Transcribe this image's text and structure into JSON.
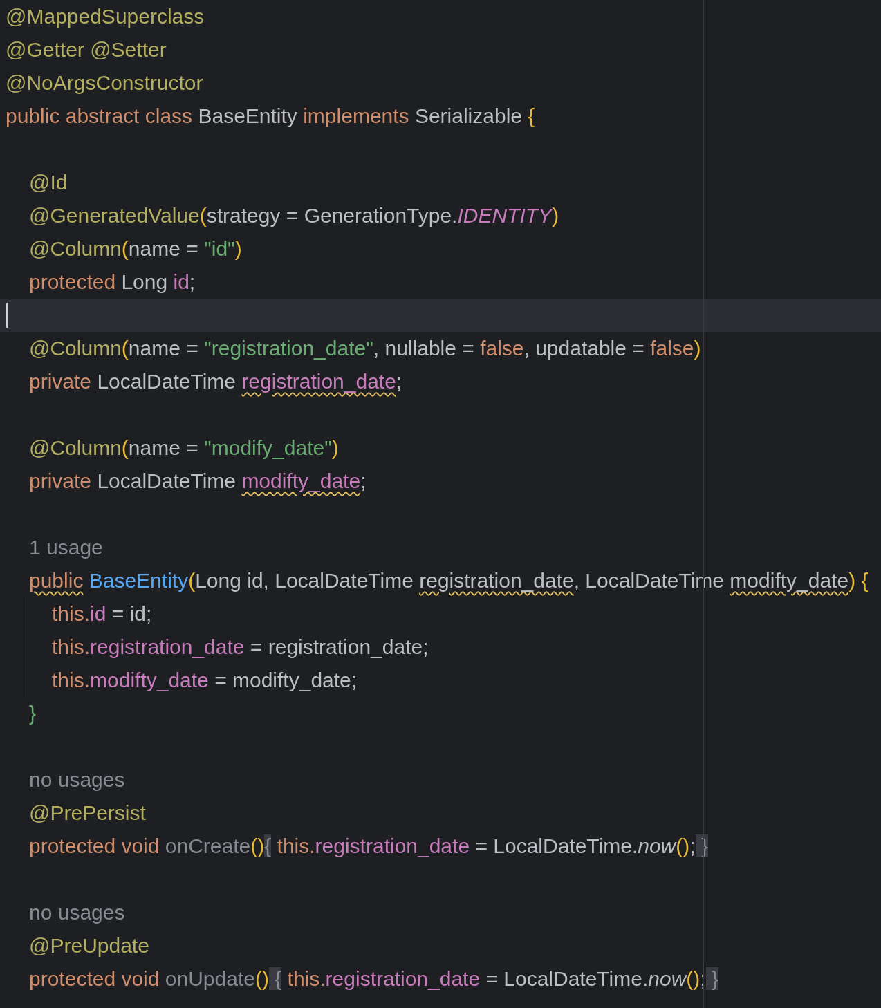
{
  "editor": {
    "lines": [
      {
        "kind": "code",
        "current": false,
        "tokens": [
          {
            "text": "@MappedSuperclass",
            "kind": "annotation"
          }
        ]
      },
      {
        "kind": "code",
        "current": false,
        "tokens": [
          {
            "text": "@Getter @Setter",
            "kind": "annotation"
          }
        ]
      },
      {
        "kind": "code",
        "current": false,
        "tokens": [
          {
            "text": "@NoArgsConstructor",
            "kind": "annotation"
          }
        ]
      },
      {
        "kind": "code",
        "current": false,
        "tokens": [
          {
            "text": "public abstract class ",
            "kind": "keyword"
          },
          {
            "text": "BaseEntity ",
            "kind": "plain"
          },
          {
            "text": "implements ",
            "kind": "keyword"
          },
          {
            "text": "Serializable ",
            "kind": "plain"
          },
          {
            "text": "{",
            "kind": "bracket"
          }
        ],
        "children": [
          {
            "kind": "blank",
            "current": false
          },
          {
            "kind": "code",
            "current": false,
            "tokens": [
              {
                "text": "@Id",
                "kind": "annotation"
              }
            ]
          },
          {
            "kind": "code",
            "current": false,
            "tokens": [
              {
                "text": "@GeneratedValue",
                "kind": "annotation"
              },
              {
                "text": "(",
                "kind": "bracket"
              },
              {
                "text": "strategy = GenerationType.",
                "kind": "plain"
              },
              {
                "text": "IDENTITY",
                "kind": "constant"
              },
              {
                "text": ")",
                "kind": "bracket"
              }
            ]
          },
          {
            "kind": "code",
            "current": false,
            "tokens": [
              {
                "text": "@Column",
                "kind": "annotation"
              },
              {
                "text": "(",
                "kind": "bracket"
              },
              {
                "text": "name = ",
                "kind": "plain"
              },
              {
                "text": "\"id\"",
                "kind": "string"
              },
              {
                "text": ")",
                "kind": "bracket"
              }
            ]
          },
          {
            "kind": "code",
            "current": false,
            "tokens": [
              {
                "text": "protected ",
                "kind": "keyword"
              },
              {
                "text": "Long ",
                "kind": "plain"
              },
              {
                "text": "id",
                "kind": "field"
              },
              {
                "text": ";",
                "kind": "plain"
              }
            ]
          },
          {
            "kind": "blank",
            "current": true
          },
          {
            "kind": "code",
            "current": false,
            "tokens": [
              {
                "text": "@Column",
                "kind": "annotation"
              },
              {
                "text": "(",
                "kind": "bracket"
              },
              {
                "text": "name = ",
                "kind": "plain"
              },
              {
                "text": "\"registration_date\"",
                "kind": "string"
              },
              {
                "text": ", nullable = ",
                "kind": "plain"
              },
              {
                "text": "false",
                "kind": "keyword"
              },
              {
                "text": ", updatable = ",
                "kind": "plain"
              },
              {
                "text": "false",
                "kind": "keyword"
              },
              {
                "text": ")",
                "kind": "bracket"
              }
            ]
          },
          {
            "kind": "code",
            "current": false,
            "tokens": [
              {
                "text": "private ",
                "kind": "keyword"
              },
              {
                "text": "LocalDateTime ",
                "kind": "plain"
              },
              {
                "text": "registration_date",
                "kind": "field",
                "squiggle": true
              },
              {
                "text": ";",
                "kind": "plain"
              }
            ]
          },
          {
            "kind": "blank",
            "current": false
          },
          {
            "kind": "code",
            "current": false,
            "tokens": [
              {
                "text": "@Column",
                "kind": "annotation"
              },
              {
                "text": "(",
                "kind": "bracket"
              },
              {
                "text": "name = ",
                "kind": "plain"
              },
              {
                "text": "\"modify_date\"",
                "kind": "string"
              },
              {
                "text": ")",
                "kind": "bracket"
              }
            ]
          },
          {
            "kind": "code",
            "current": false,
            "tokens": [
              {
                "text": "private ",
                "kind": "keyword"
              },
              {
                "text": "LocalDateTime ",
                "kind": "plain"
              },
              {
                "text": "modifty_date",
                "kind": "field",
                "squiggle": true
              },
              {
                "text": ";",
                "kind": "plain"
              }
            ]
          },
          {
            "kind": "blank",
            "current": false
          },
          {
            "kind": "hint",
            "current": false,
            "tokens": [
              {
                "text": "1 usage",
                "kind": "hint"
              }
            ]
          },
          {
            "kind": "code",
            "current": false,
            "tokens": [
              {
                "text": "public",
                "kind": "keyword",
                "squiggle": true
              },
              {
                "text": " BaseEntity",
                "kind": "declaration"
              },
              {
                "text": "(",
                "kind": "bracket"
              },
              {
                "text": "Long id, LocalDateTime ",
                "kind": "plain"
              },
              {
                "text": "registration_date",
                "kind": "plain",
                "squiggle": true
              },
              {
                "text": ", LocalDateTime ",
                "kind": "plain"
              },
              {
                "text": "modifty_date",
                "kind": "plain",
                "squiggle": true
              },
              {
                "text": ") {",
                "kind": "bracket"
              }
            ],
            "children": [
              {
                "kind": "code",
                "current": false,
                "tokens": [
                  {
                    "text": "this.",
                    "kind": "keyword"
                  },
                  {
                    "text": "id",
                    "kind": "field"
                  },
                  {
                    "text": " = id;",
                    "kind": "plain"
                  }
                ]
              },
              {
                "kind": "code",
                "current": false,
                "tokens": [
                  {
                    "text": "this.",
                    "kind": "keyword"
                  },
                  {
                    "text": "registration_date",
                    "kind": "field"
                  },
                  {
                    "text": " = registration_date;",
                    "kind": "plain"
                  }
                ]
              },
              {
                "kind": "code",
                "current": false,
                "tokens": [
                  {
                    "text": "this.",
                    "kind": "keyword"
                  },
                  {
                    "text": "modifty_date",
                    "kind": "field"
                  },
                  {
                    "text": " = modifty_date;",
                    "kind": "plain"
                  }
                ]
              }
            ]
          },
          {
            "kind": "code",
            "current": false,
            "tokens": [
              {
                "text": "}",
                "kind": "bracket-green"
              }
            ]
          },
          {
            "kind": "blank",
            "current": false
          },
          {
            "kind": "hint",
            "current": false,
            "tokens": [
              {
                "text": "no usages",
                "kind": "hint"
              }
            ]
          },
          {
            "kind": "code",
            "current": false,
            "tokens": [
              {
                "text": "@PrePersist",
                "kind": "annotation"
              }
            ]
          },
          {
            "kind": "code",
            "current": false,
            "tokens": [
              {
                "text": "protected void ",
                "kind": "keyword"
              },
              {
                "text": "onCreate",
                "kind": "unused"
              },
              {
                "text": "()",
                "kind": "bracket"
              },
              {
                "text": "{",
                "kind": "fold"
              },
              {
                "text": " this.",
                "kind": "keyword"
              },
              {
                "text": "registration_date",
                "kind": "field"
              },
              {
                "text": " = LocalDateTime.",
                "kind": "plain"
              },
              {
                "text": "now",
                "kind": "call"
              },
              {
                "text": "()",
                "kind": "bracket"
              },
              {
                "text": ";",
                "kind": "plain"
              },
              {
                "text": " }",
                "kind": "fold"
              }
            ]
          },
          {
            "kind": "blank",
            "current": false
          },
          {
            "kind": "hint",
            "current": false,
            "tokens": [
              {
                "text": "no usages",
                "kind": "hint"
              }
            ]
          },
          {
            "kind": "code",
            "current": false,
            "tokens": [
              {
                "text": "@PreUpdate",
                "kind": "annotation"
              }
            ]
          },
          {
            "kind": "code",
            "current": false,
            "tokens": [
              {
                "text": "protected void ",
                "kind": "keyword"
              },
              {
                "text": "onUpdate",
                "kind": "unused"
              },
              {
                "text": "()",
                "kind": "bracket"
              },
              {
                "text": " {",
                "kind": "fold"
              },
              {
                "text": " this.",
                "kind": "keyword"
              },
              {
                "text": "registration_date",
                "kind": "field"
              },
              {
                "text": " = LocalDateTime.",
                "kind": "plain"
              },
              {
                "text": "now",
                "kind": "call"
              },
              {
                "text": "()",
                "kind": "bracket"
              },
              {
                "text": ";",
                "kind": "plain"
              },
              {
                "text": " }",
                "kind": "fold"
              }
            ]
          }
        ]
      }
    ]
  }
}
